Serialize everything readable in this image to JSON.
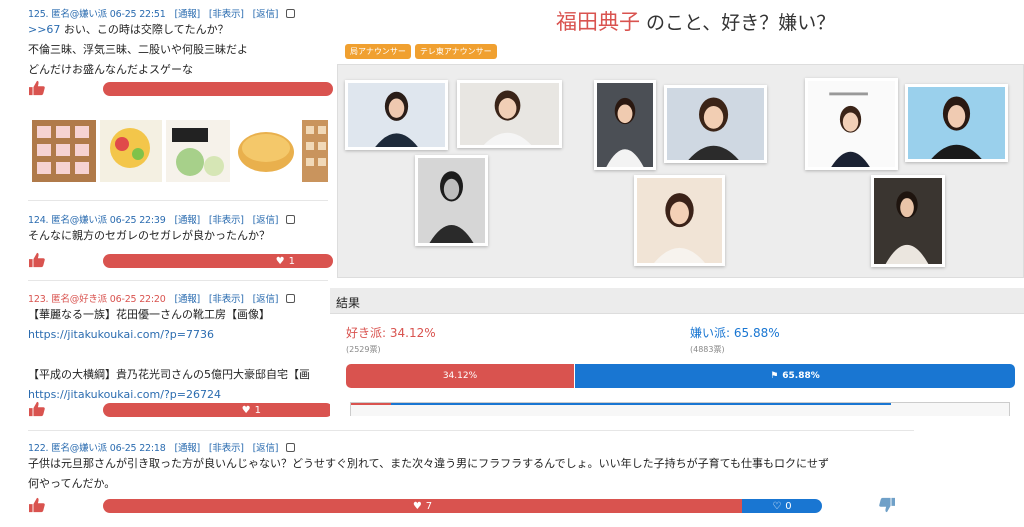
{
  "comments": [
    {
      "meta": "125. 匿名@嫌い派 06-25 22:51",
      "links": [
        "[通報]",
        "[非表示]",
        "[返信]"
      ],
      "reply_ref": ">>67",
      "lines": [
        " おい、この時は交際してたんか？",
        "不倫三昧、浮気三昧、二股いや何股三昧だよ",
        "どんだけお盛んなんだよスゲーな"
      ]
    },
    {
      "meta": "124. 匿名@嫌い派 06-25 22:39",
      "links": [
        "[通報]",
        "[非表示]",
        "[返信]"
      ],
      "lines": [
        "そんなに親方のセガレのセガレが良かったんか？"
      ],
      "like_count": "1"
    },
    {
      "meta": "123. 匿名@好き派 06-25 22:20",
      "links": [
        "[通報]",
        "[非表示]",
        "[返信]"
      ],
      "lines": [
        "【華麗なる一族】花田優一さんの靴工房【画像】",
        "https://jitakukoukai.com/?p=7736",
        "",
        "【平成の大横綱】貴乃花光司さんの5億円大豪邸自宅【画",
        "https://jitakukoukai.com/?p=26724"
      ],
      "like_count": "1"
    },
    {
      "meta": "122. 匿名@嫌い派 06-25 22:18",
      "links": [
        "[通報]",
        "[非表示]",
        "[返信]"
      ],
      "lines": [
        "子供は元旦那さんが引き取った方が良いんじゃない？どうせすぐ別れて、また次々違う男にフラフラするんでしょ。いい年した子持ちが子育ても仕事もロクにせず",
        "何やってんだか。"
      ],
      "like_count": "7",
      "dislike_count": "0"
    }
  ],
  "poll": {
    "name": "福田典子",
    "title_rest": "のこと、好き？嫌い？",
    "tags": [
      "局アナウンサー",
      "テレ東アナウンサー"
    ],
    "results_label": "結果",
    "like_label": "好き派: 34.12%",
    "like_votes": "(2529票)",
    "dislike_label": "嫌い派: 65.88%",
    "dislike_votes": "(4883票)",
    "like_pct_text": "34.12%",
    "dislike_pct_text": "65.88%",
    "like_fraction": 0.3412,
    "dislike_fraction": 0.6588
  },
  "colors": {
    "like_red": "#d9534f",
    "dislike_blue": "#1976d2",
    "link_blue": "#2b6cb0",
    "tag_orange": "#f0a030"
  }
}
